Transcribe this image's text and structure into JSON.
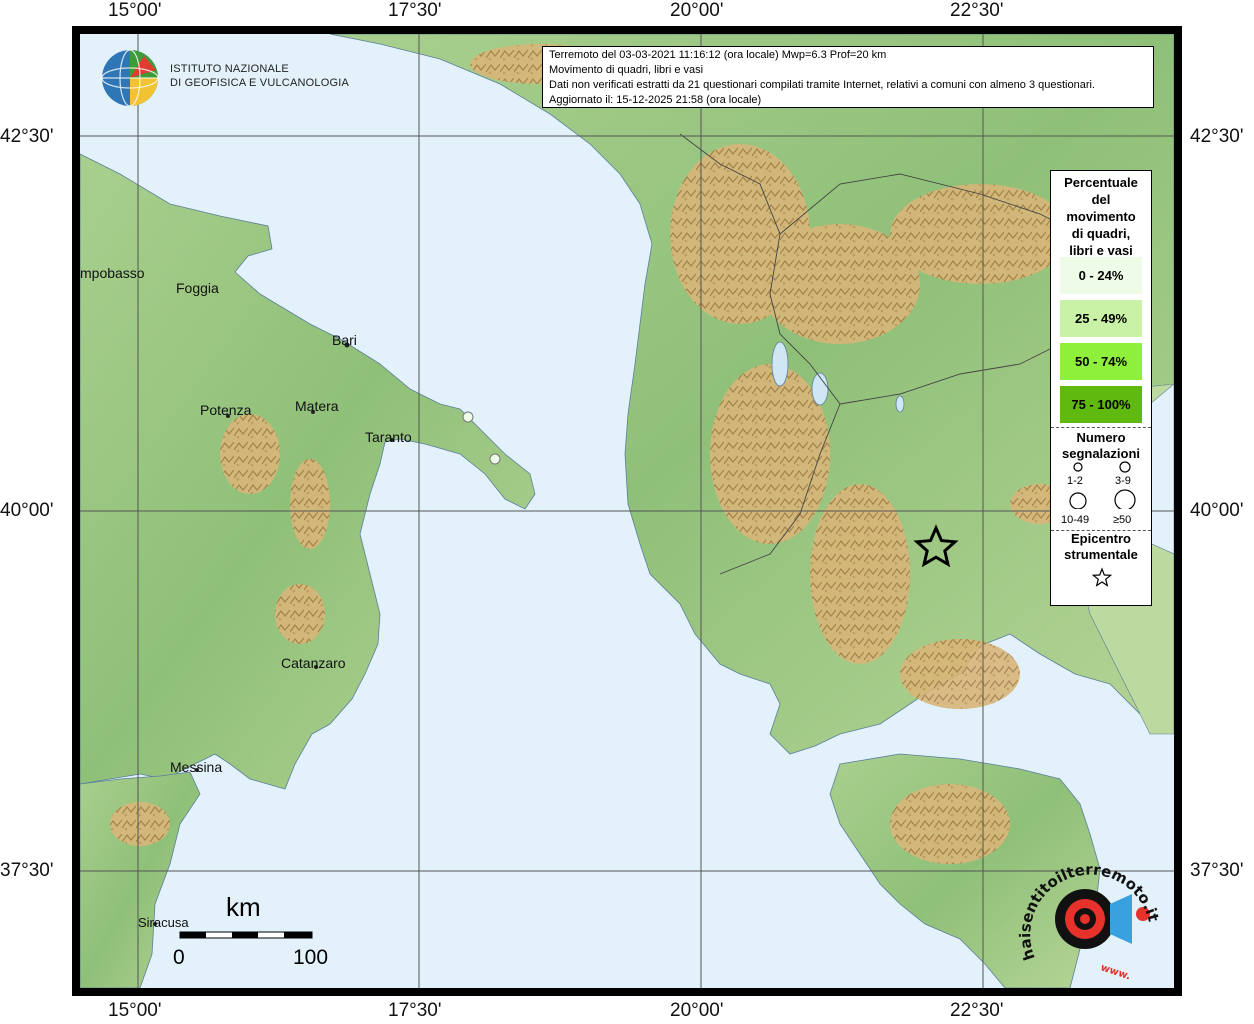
{
  "header": {
    "line1": "Terremoto del 03-03-2021 11:16:12 (ora locale) Mwp=6.3 Prof=20 km",
    "line2": "Movimento di quadri, libri e vasi",
    "line3": "Dati non verificati estratti da 21 questionari compilati tramite Internet, relativi a comuni con almeno 3 questionari.",
    "line4": "Aggiornato il: 15-12-2025 21:58 (ora locale)"
  },
  "institute": {
    "line1": "Istituto Nazionale",
    "line2": "di Geofisica e Vulcanologia"
  },
  "axes": {
    "lon_labels": [
      "15°00'",
      "17°30'",
      "20°00'",
      "22°30'"
    ],
    "lat_labels": [
      "42°30'",
      "40°00'",
      "37°30'"
    ]
  },
  "cities": [
    {
      "name": "mpobasso"
    },
    {
      "name": "Foggia"
    },
    {
      "name": "Bari"
    },
    {
      "name": "Potenza"
    },
    {
      "name": "Matera"
    },
    {
      "name": "Taranto"
    },
    {
      "name": "Catanzaro"
    },
    {
      "name": "Messina"
    },
    {
      "name": "Siracusa"
    }
  ],
  "legend": {
    "title": [
      "Percentuale",
      "del",
      "movimento",
      "di quadri,",
      "libri e vasi"
    ],
    "classes": [
      {
        "label": "0 - 24%",
        "color": "#eefbe6"
      },
      {
        "label": "25 - 49%",
        "color": "#c9f2a6"
      },
      {
        "label": "50 - 74%",
        "color": "#8ef03a"
      },
      {
        "label": "75 - 100%",
        "color": "#5fb90e"
      }
    ],
    "count_title": [
      "Numero",
      "segnalazioni"
    ],
    "counts": [
      "1-2",
      "3-9",
      "10-49",
      "≥50"
    ],
    "epicenter_title": [
      "Epicentro",
      "strumentale"
    ]
  },
  "observations": [
    {
      "class": "0 - 24%",
      "count": "1-2"
    },
    {
      "class": "0 - 24%",
      "count": "1-2"
    }
  ],
  "scale": {
    "unit": "km",
    "min": "0",
    "max": "100"
  },
  "watermark": {
    "text": "haisentitoilterremoto.it",
    "prefix": "www."
  }
}
